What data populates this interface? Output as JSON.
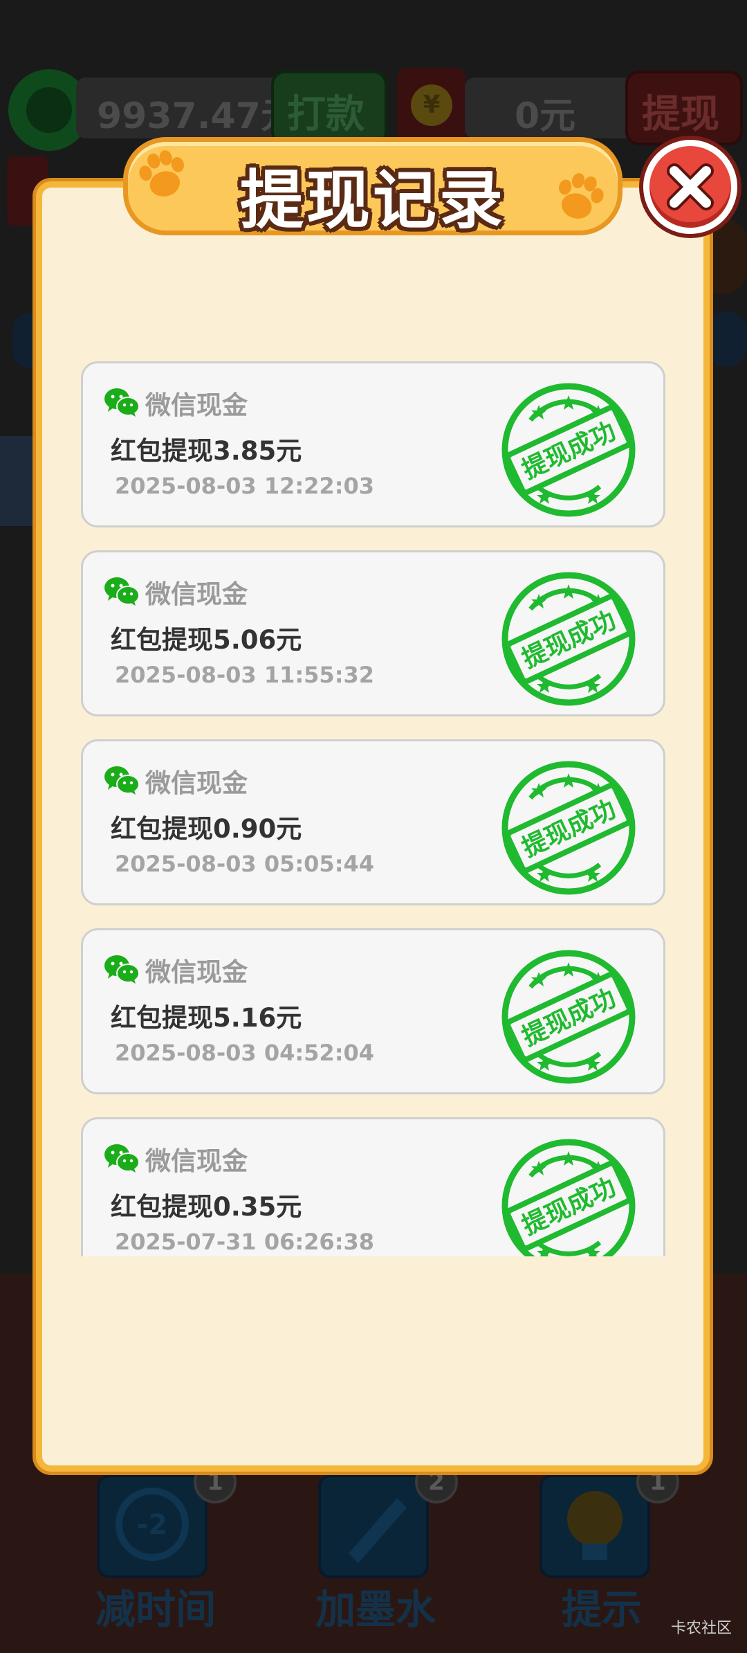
{
  "background": {
    "balance": "9937.47元",
    "pay_label": "打款",
    "yuan_symbol": "¥",
    "cash_value": "0元",
    "withdraw_label": "提现",
    "tools": [
      {
        "label": "减时间",
        "badge": "1",
        "icon_text": "-2"
      },
      {
        "label": "加墨水",
        "badge": "2"
      },
      {
        "label": "提示",
        "badge": "1"
      }
    ]
  },
  "modal": {
    "title": "提现记录",
    "close_icon": "close-icon",
    "accent": "#f4b73b",
    "records": [
      {
        "source": "微信现金",
        "amount": "红包提现3.85元",
        "time": "2025-08-03 12:22:03",
        "status": "提现成功"
      },
      {
        "source": "微信现金",
        "amount": "红包提现5.06元",
        "time": "2025-08-03 11:55:32",
        "status": "提现成功"
      },
      {
        "source": "微信现金",
        "amount": "红包提现0.90元",
        "time": "2025-08-03 05:05:44",
        "status": "提现成功"
      },
      {
        "source": "微信现金",
        "amount": "红包提现5.16元",
        "time": "2025-08-03 04:52:04",
        "status": "提现成功"
      },
      {
        "source": "微信现金",
        "amount": "红包提现0.35元",
        "time": "2025-07-31 06:26:38",
        "status": "提现成功"
      }
    ]
  },
  "watermark": "卡农社区",
  "colors": {
    "stamp_green": "#1fba2f",
    "wechat_green": "#1aad19",
    "close_red": "#e8473c"
  }
}
